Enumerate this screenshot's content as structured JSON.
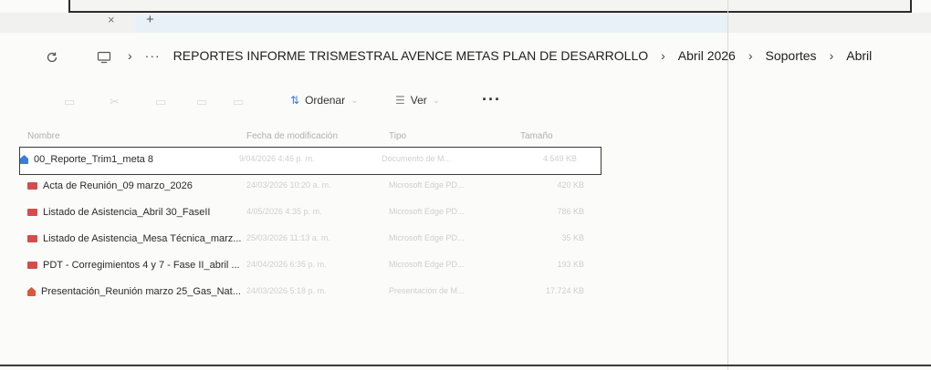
{
  "tabbar": {
    "close_glyph": "×",
    "new_glyph": "+"
  },
  "address": {
    "refresh_icon": "refresh-icon",
    "device_icon": "monitor-icon",
    "more_crumbs": "···",
    "crumbs": [
      "REPORTES INFORME TRISMESTRAL AVENCE METAS PLAN DE DESARROLLO",
      "Abril 2026",
      "Soportes",
      "Abril"
    ]
  },
  "toolbar": {
    "sort_label": "Ordenar",
    "view_label": "Ver",
    "more_label": "···"
  },
  "list": {
    "columns": {
      "name": "Nombre",
      "date": "Fecha de modificación",
      "type": "Tipo",
      "size": "Tamaño"
    },
    "rows": [
      {
        "icon": "word",
        "name": "00_Reporte_Trim1_meta 8",
        "date": "9/04/2026 4:46 p. m.",
        "type": "Documento de M...",
        "size": "4.549 KB",
        "selected": true
      },
      {
        "icon": "pdf",
        "name": "Acta de Reunión_09 marzo_2026",
        "date": "24/03/2026 10:20 a. m.",
        "type": "Microsoft Edge PD...",
        "size": "420 KB",
        "selected": false
      },
      {
        "icon": "pdf",
        "name": "Listado de Asistencia_Abril 30_FaseII",
        "date": "4/05/2026 4:35 p. m.",
        "type": "Microsoft Edge PD...",
        "size": "786 KB",
        "selected": false
      },
      {
        "icon": "pdf",
        "name": "Listado de Asistencia_Mesa Técnica_marz...",
        "date": "25/03/2026 11:13 a. m.",
        "type": "Microsoft Edge PD...",
        "size": "35 KB",
        "selected": false
      },
      {
        "icon": "pdf",
        "name": "PDT - Corregimientos 4 y 7 - Fase II_abril ...",
        "date": "24/04/2026 6:35 p. m.",
        "type": "Microsoft Edge PD...",
        "size": "193 KB",
        "selected": false
      },
      {
        "icon": "ppt",
        "name": "Presentación_Reunión marzo 25_Gas_Nat...",
        "date": "24/03/2026 5:18 p. m.",
        "type": "Presentación de M...",
        "size": "17.724 KB",
        "selected": false
      }
    ]
  }
}
